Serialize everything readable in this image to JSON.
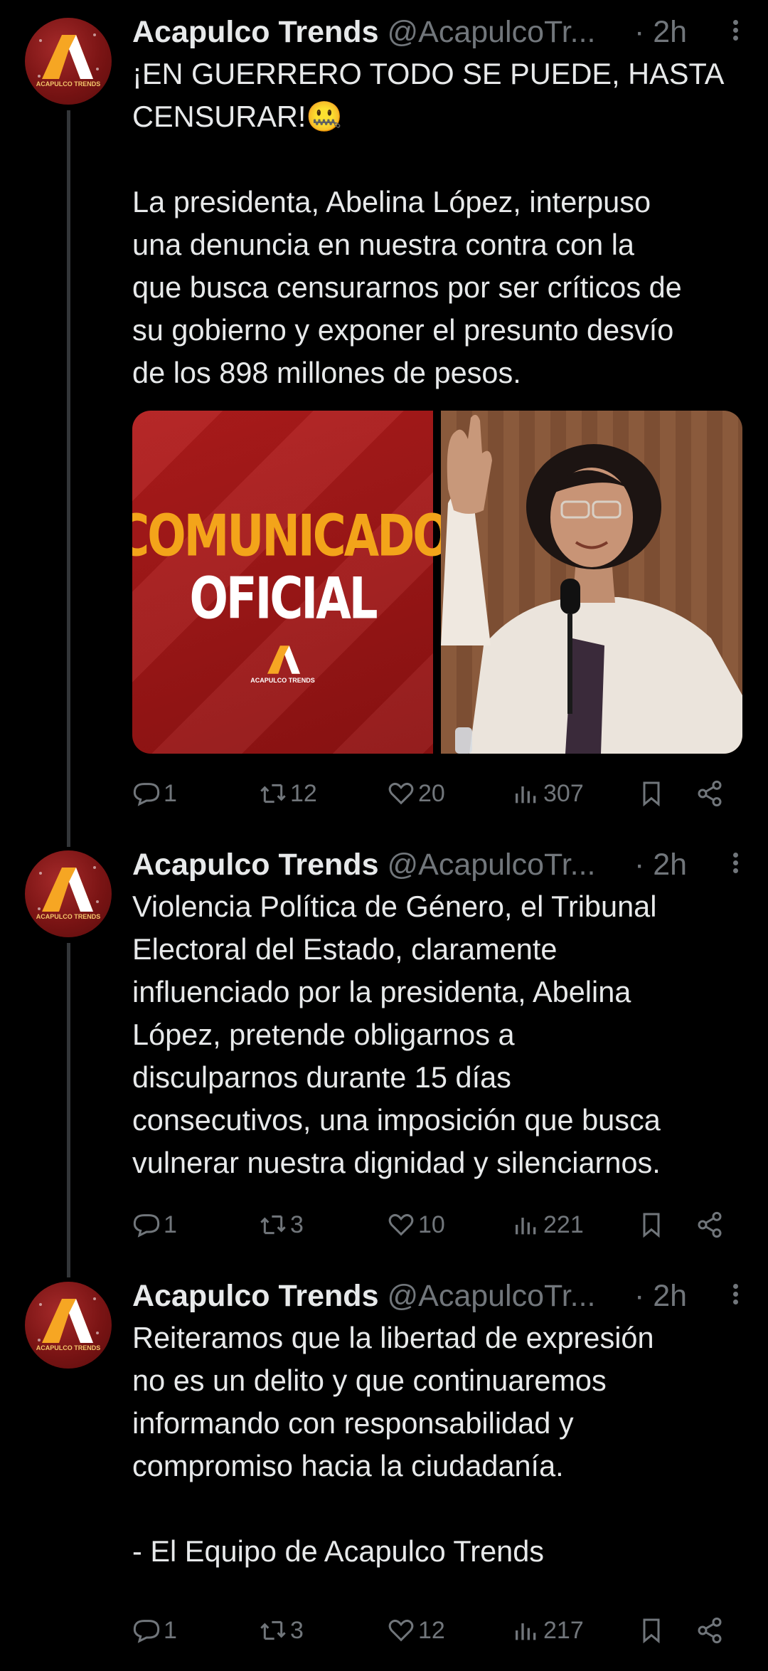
{
  "colors": {
    "background": "#000000",
    "text": "#e7e9ea",
    "muted": "#71767b",
    "avatar": "#7a1414"
  },
  "tweets": [
    {
      "name": "Acapulco Trends",
      "handle": "@AcapulcoTr...",
      "time": "· 2h",
      "text": "¡EN GUERRERO TODO SE PUEDE, HASTA\nCENSURAR!🤐\n\nLa presidenta, Abelina López, interpuso\nuna denuncia en nuestra contra con la\nque busca censurarnos por ser críticos de\nsu gobierno y exponer el presunto desvío\nde los 898 millones de pesos.",
      "media": {
        "headline_1": "COMUNICADO",
        "headline_2": "OFICIAL",
        "logo": "ACAPULCO TRENDS"
      },
      "replies": "1",
      "reposts": "12",
      "likes": "20",
      "views": "307"
    },
    {
      "name": "Acapulco Trends",
      "handle": "@AcapulcoTr...",
      "time": "· 2h",
      "text": "Violencia Política de Género, el Tribunal\nElectoral del Estado, claramente\ninfluenciado por la presidenta, Abelina\nLópez, pretende obligarnos a\ndisculparnos durante 15 días\nconsecutivos, una imposición que busca\nvulnerar nuestra dignidad y silenciarnos.",
      "replies": "1",
      "reposts": "3",
      "likes": "10",
      "views": "221"
    },
    {
      "name": "Acapulco Trends",
      "handle": "@AcapulcoTr...",
      "time": "· 2h",
      "text": "Reiteramos que la libertad de expresión\nno es un delito y que continuaremos\ninformando con responsabilidad y\ncompromiso hacia la ciudadanía.\n\n- El Equipo de Acapulco Trends",
      "replies": "1",
      "reposts": "3",
      "likes": "12",
      "views": "217"
    }
  ]
}
